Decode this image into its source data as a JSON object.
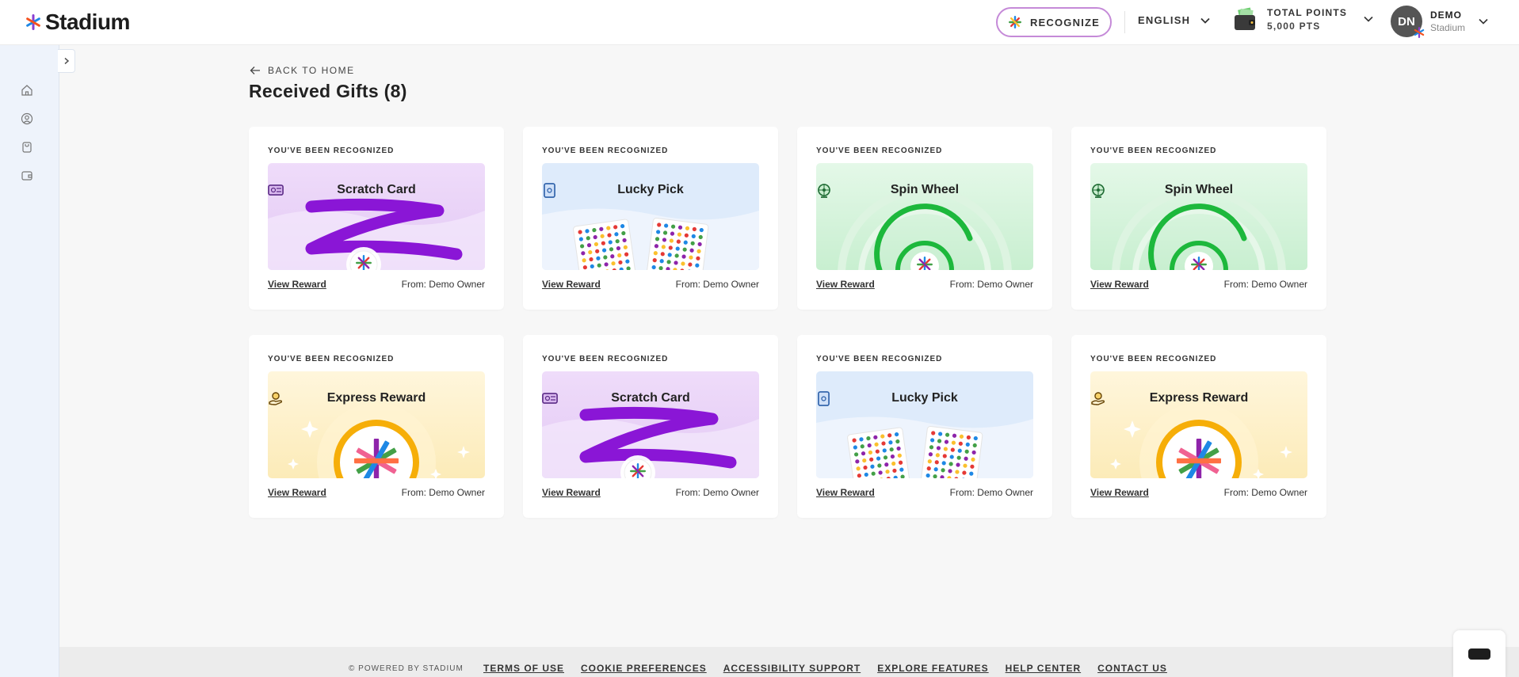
{
  "header": {
    "logo_text": "Stadium",
    "recognize_label": "RECOGNIZE",
    "language_label": "ENGLISH",
    "points_title": "TOTAL POINTS",
    "points_value": "5,000 PTS",
    "user_initials": "DN",
    "user_name": "DEMO",
    "user_org": "Stadium"
  },
  "sidebar": {
    "icons": [
      "home-icon",
      "recognition-icon",
      "shopping-bag-icon",
      "wallet-icon"
    ]
  },
  "page": {
    "back_label": "BACK TO HOME",
    "title": "Received Gifts (8)"
  },
  "gifts": [
    {
      "kicker": "YOU'VE BEEN RECOGNIZED",
      "name": "Scratch Card",
      "type": "scratch",
      "view_label": "View Reward",
      "from": "From: Demo Owner"
    },
    {
      "kicker": "YOU'VE BEEN RECOGNIZED",
      "name": "Lucky Pick",
      "type": "lucky",
      "view_label": "View Reward",
      "from": "From: Demo Owner"
    },
    {
      "kicker": "YOU'VE BEEN RECOGNIZED",
      "name": "Spin Wheel",
      "type": "spin",
      "view_label": "View Reward",
      "from": "From: Demo Owner"
    },
    {
      "kicker": "YOU'VE BEEN RECOGNIZED",
      "name": "Spin Wheel",
      "type": "spin",
      "view_label": "View Reward",
      "from": "From: Demo Owner"
    },
    {
      "kicker": "YOU'VE BEEN RECOGNIZED",
      "name": "Express Reward",
      "type": "express",
      "view_label": "View Reward",
      "from": "From: Demo Owner"
    },
    {
      "kicker": "YOU'VE BEEN RECOGNIZED",
      "name": "Scratch Card",
      "type": "scratch",
      "view_label": "View Reward",
      "from": "From: Demo Owner"
    },
    {
      "kicker": "YOU'VE BEEN RECOGNIZED",
      "name": "Lucky Pick",
      "type": "lucky",
      "view_label": "View Reward",
      "from": "From: Demo Owner"
    },
    {
      "kicker": "YOU'VE BEEN RECOGNIZED",
      "name": "Express Reward",
      "type": "express",
      "view_label": "View Reward",
      "from": "From: Demo Owner"
    }
  ],
  "footer": {
    "copyright": "© POWERED BY STADIUM",
    "links": [
      "TERMS OF USE",
      "COOKIE PREFERENCES",
      "ACCESSIBILITY SUPPORT",
      "EXPLORE FEATURES",
      "HELP CENTER",
      "CONTACT US"
    ]
  },
  "colors": {
    "scratch_bg": "#ebd6f7",
    "lucky_bg": "#deebfb",
    "spin_bg": "#d6f3dc",
    "express_bg": "#fdf0cc",
    "scratch_stroke": "#8a16d6",
    "spin_ring": "#1db83c",
    "express_ring": "#f6ae08"
  }
}
